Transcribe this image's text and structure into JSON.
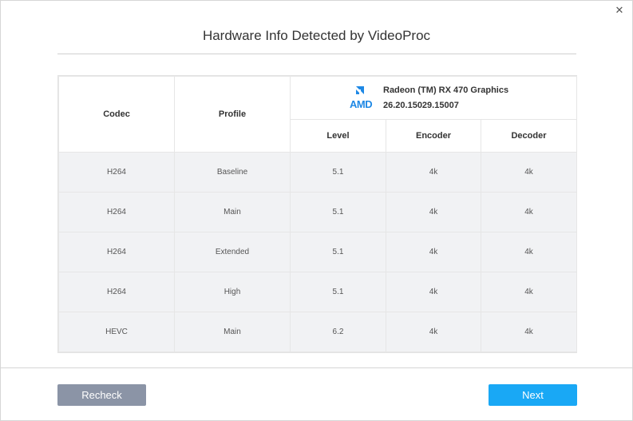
{
  "dialog": {
    "title": "Hardware Info Detected by VideoProc",
    "close_glyph": "✕"
  },
  "gpu": {
    "brand": "AMD",
    "name": "Radeon (TM) RX 470 Graphics",
    "driver_version": "26.20.15029.15007"
  },
  "table": {
    "headers": {
      "codec": "Codec",
      "profile": "Profile",
      "level": "Level",
      "encoder": "Encoder",
      "decoder": "Decoder"
    },
    "rows": [
      {
        "codec": "H264",
        "profile": "Baseline",
        "level": "5.1",
        "encoder": "4k",
        "decoder": "4k"
      },
      {
        "codec": "H264",
        "profile": "Main",
        "level": "5.1",
        "encoder": "4k",
        "decoder": "4k"
      },
      {
        "codec": "H264",
        "profile": "Extended",
        "level": "5.1",
        "encoder": "4k",
        "decoder": "4k"
      },
      {
        "codec": "H264",
        "profile": "High",
        "level": "5.1",
        "encoder": "4k",
        "decoder": "4k"
      },
      {
        "codec": "HEVC",
        "profile": "Main",
        "level": "6.2",
        "encoder": "4k",
        "decoder": "4k"
      }
    ]
  },
  "buttons": {
    "recheck": "Recheck",
    "next": "Next"
  },
  "colors": {
    "amd_blue": "#1e88e5",
    "next_button": "#19a8f5",
    "recheck_button": "#8b94a6"
  }
}
